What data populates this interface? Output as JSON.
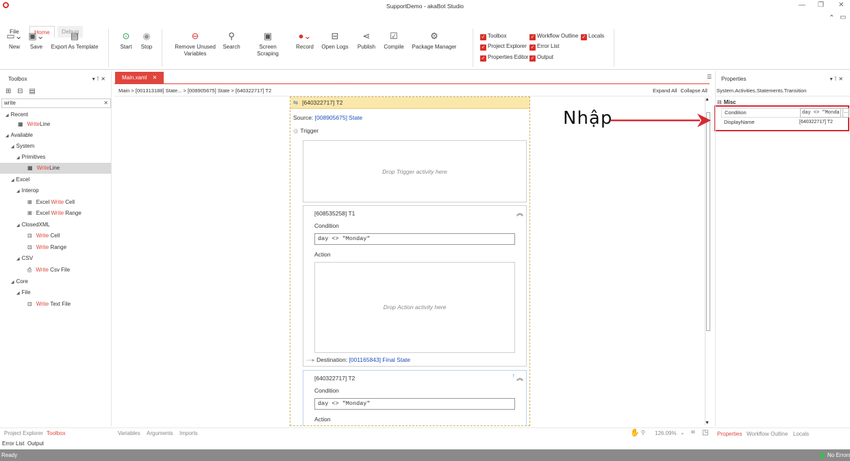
{
  "app": {
    "title": "SupportDemo - akaBot Studio"
  },
  "ribbon_tabs": [
    "File",
    "Home",
    "Debug"
  ],
  "ribbon": {
    "new": "New",
    "save": "Save",
    "export_template": "Export As Template",
    "start": "Start",
    "stop": "Stop",
    "remove_unused": "Remove Unused\nVariables",
    "search": "Search",
    "screen_scraping": "Screen Scraping",
    "record": "Record",
    "open_logs": "Open Logs",
    "publish": "Publish",
    "compile": "Compile",
    "package_manager": "Package Manager",
    "checks": {
      "toolbox": "Toolbox",
      "project_explorer": "Project Explorer",
      "properties_editor": "Properties Editor",
      "workflow_outline": "Workflow Outline",
      "error_list": "Error List",
      "output": "Output",
      "locals": "Locals"
    }
  },
  "toolbox": {
    "title": "Toolbox",
    "search_value": "write",
    "tree": {
      "recent": "Recent",
      "available": "Available",
      "system": "System",
      "primitives": "Primitives",
      "excel": "Excel",
      "interop": "Interop",
      "closedxml": "ClosedXML",
      "csv": "CSV",
      "core": "Core",
      "file": "File"
    },
    "items": {
      "write": "Write",
      "line": "Line",
      "excel_prefix": "Excel ",
      "cell": " Cell",
      "range": " Range",
      "csv_file": " Csv File",
      "text_file": " Text File"
    }
  },
  "designer": {
    "tab": "Main.xaml",
    "breadcrumb": [
      "Main",
      "[001313188] State...",
      "[008905675] State",
      "[640322717] T2"
    ],
    "expand_all": "Expand All",
    "collapse_all": "Collapse All",
    "header": "[640322717] T2",
    "source_label": "Source: ",
    "source_link": "[008905675] State",
    "trigger": "Trigger",
    "drop_trigger": "Drop Trigger activity here",
    "t1": {
      "title": "[608535258] T1",
      "condition_label": "Condition",
      "condition_value": "day <> \"Monday\"",
      "action_label": "Action",
      "drop_action": "Drop Action activity here",
      "destination_label": "Destination: ",
      "destination_link": "[001165843] Final State"
    },
    "t2": {
      "title": "[640322717] T2",
      "condition_label": "Condition",
      "condition_value": "day <> \"Monday\"",
      "action_label": "Action"
    }
  },
  "annotation": {
    "text": "Nhập",
    "color": "#d62a34"
  },
  "properties": {
    "title": "Properties",
    "type": "System.Activities.Statements.Transition",
    "category": "Misc",
    "rows": [
      {
        "name": "Condition",
        "value": "day <> \"Monda"
      },
      {
        "name": "DisplayName",
        "value": "[640322717] T2"
      }
    ],
    "ellipsis": "..."
  },
  "bottom": {
    "left_tabs": [
      "Project Explorer",
      "Toolbox"
    ],
    "center_tabs": [
      "Variables",
      "Arguments",
      "Imports"
    ],
    "zoom": "126.09%",
    "right_tabs": [
      "Properties",
      "Workflow Outline",
      "Locals"
    ],
    "second_row": [
      "Error List",
      "Output"
    ]
  },
  "status": {
    "ready": "Ready",
    "errors": "No Errors"
  },
  "colors": {
    "accent": "#e0453c",
    "link": "#1a4fb5",
    "checkbox": "#d9312b"
  }
}
